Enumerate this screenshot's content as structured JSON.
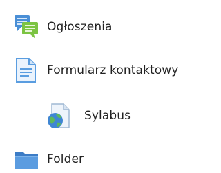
{
  "items": [
    {
      "label": "Ogłoszenia",
      "icon": "forum-icon"
    },
    {
      "label": "Formularz kontaktowy",
      "icon": "page-icon"
    },
    {
      "label": "Sylabus",
      "icon": "url-icon"
    },
    {
      "label": "Folder",
      "icon": "folder-icon"
    }
  ],
  "colors": {
    "forum_blue": "#4a8fd6",
    "forum_green": "#7cc442",
    "page_blue": "#5a9de0",
    "folder_blue": "#4d8fd9",
    "globe_green": "#5cb85c",
    "text": "#222222"
  }
}
